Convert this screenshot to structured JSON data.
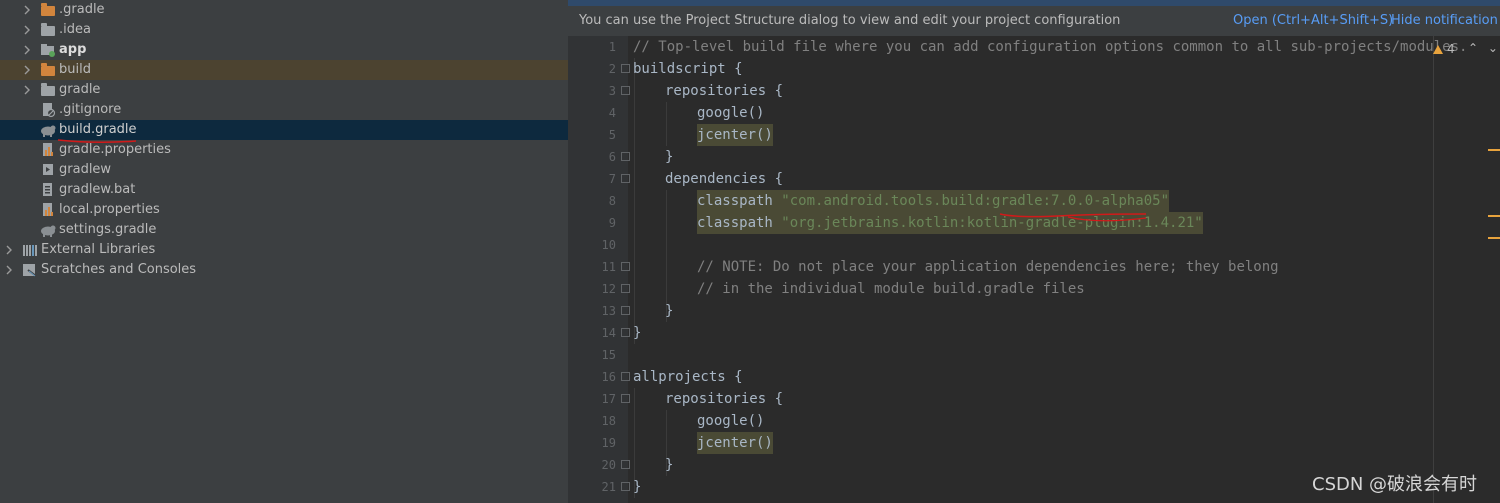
{
  "tree": {
    "items": [
      {
        "label": ".gradle",
        "icon": "folder-excluded-icon"
      },
      {
        "label": ".idea",
        "icon": "folder-icon"
      },
      {
        "label": "app",
        "icon": "module-folder-icon"
      },
      {
        "label": "build",
        "icon": "folder-excluded-icon"
      },
      {
        "label": "gradle",
        "icon": "folder-icon"
      },
      {
        "label": ".gitignore",
        "icon": "ignore-file-icon"
      },
      {
        "label": "build.gradle",
        "icon": "gradle-elephant-icon"
      },
      {
        "label": "gradle.properties",
        "icon": "properties-file-icon"
      },
      {
        "label": "gradlew",
        "icon": "script-file-icon"
      },
      {
        "label": "gradlew.bat",
        "icon": "script-file-icon"
      },
      {
        "label": "local.properties",
        "icon": "properties-file-icon"
      },
      {
        "label": "settings.gradle",
        "icon": "gradle-elephant-icon"
      },
      {
        "label": "External Libraries",
        "icon": "libraries-icon"
      },
      {
        "label": "Scratches and Consoles",
        "icon": "scratches-icon"
      }
    ]
  },
  "notification": {
    "message": "You can use the Project Structure dialog to view and edit your project configuration",
    "open_label": "Open (Ctrl+Alt+Shift+S)",
    "hide_label": "Hide notification"
  },
  "editor": {
    "warnings_count": "4",
    "line_numbers": [
      "1",
      "2",
      "3",
      "4",
      "5",
      "6",
      "7",
      "8",
      "9",
      "10",
      "11",
      "12",
      "13",
      "14",
      "15",
      "16",
      "17",
      "18",
      "19",
      "20",
      "21"
    ],
    "code": {
      "l1": "// Top-level build file where you can add configuration options common to all sub-projects/modules.",
      "l2": "buildscript {",
      "l3": "repositories {",
      "l4": "google()",
      "l5": "jcenter()",
      "l6": "}",
      "l7": "dependencies {",
      "l8_kw": "classpath",
      "l8_str": "\"com.android.tools.build:gradle:7.0.0-alpha05\"",
      "l9_kw": "classpath",
      "l9_str": "\"org.jetbrains.kotlin:kotlin-gradle-plugin:1.4.21\"",
      "l11": "// NOTE: Do not place your application dependencies here; they belong",
      "l12": "// in the individual module build.gradle files",
      "l13": "}",
      "l14": "}",
      "l16": "allprojects {",
      "l17": "repositories {",
      "l18": "google()",
      "l19": "jcenter()",
      "l20": "}",
      "l21": "}"
    }
  },
  "watermark": "CSDN @破浪会有时",
  "colors": {
    "accent_link": "#589df6",
    "annotation_red": "#d11a1a",
    "string_green": "#6a8759",
    "warning_orange": "#e8a33d"
  }
}
